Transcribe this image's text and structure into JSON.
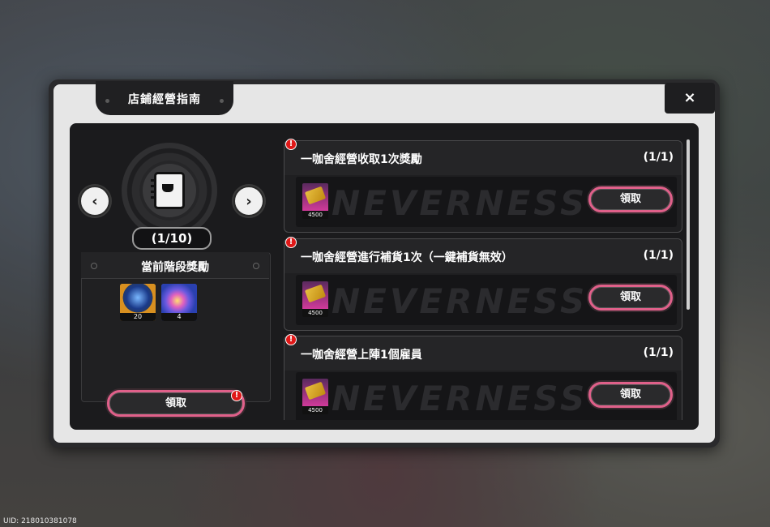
{
  "window": {
    "title": "店鋪經營指南",
    "close_label": "×"
  },
  "left": {
    "progress": "(1/10)",
    "stage_title": "當前階段獎勵",
    "rewards": [
      {
        "name": "blue-orb",
        "count": "20"
      },
      {
        "name": "galaxy-orb",
        "count": "4"
      }
    ],
    "claim_label": "領取",
    "alert": "!"
  },
  "tasks": [
    {
      "name": "一咖舍經營收取1次獎勵",
      "progress": "(1/1)",
      "reward_count": "4500",
      "claim_label": "領取",
      "alert": "!"
    },
    {
      "name": "一咖舍經營進行補貨1次（一鍵補貨無效）",
      "progress": "(1/1)",
      "reward_count": "4500",
      "claim_label": "領取",
      "alert": "!"
    },
    {
      "name": "一咖舍經營上陣1個雇員",
      "progress": "(1/1)",
      "reward_count": "4500",
      "claim_label": "領取",
      "alert": "!"
    }
  ],
  "watermark": "NEVERNESS",
  "footer": {
    "uid": "UID: 218010381078"
  },
  "colors": {
    "accent": "#e0608a",
    "alert": "#e01818",
    "panel": "#1b1b1d"
  }
}
